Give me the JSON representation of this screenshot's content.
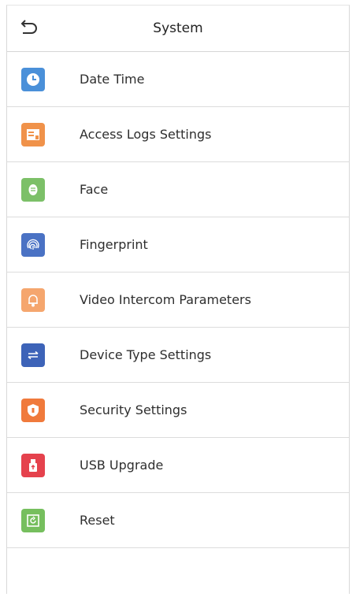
{
  "header": {
    "title": "System",
    "back_icon": "back-arrow-icon"
  },
  "colors": {
    "date_time": "#4a90d9",
    "access_logs": "#f0924a",
    "face": "#7cc068",
    "fingerprint": "#4a72c4",
    "video_intercom": "#f5a66e",
    "device_type": "#3d63b8",
    "security": "#f07a3c",
    "usb": "#e5424d",
    "reset": "#76bf5e"
  },
  "menu": {
    "items": [
      {
        "label": "Date Time",
        "icon": "clock-icon"
      },
      {
        "label": "Access Logs Settings",
        "icon": "logs-icon"
      },
      {
        "label": "Face",
        "icon": "face-icon"
      },
      {
        "label": "Fingerprint",
        "icon": "fingerprint-icon"
      },
      {
        "label": "Video Intercom Parameters",
        "icon": "bell-icon"
      },
      {
        "label": "Device Type Settings",
        "icon": "swap-arrows-icon"
      },
      {
        "label": "Security Settings",
        "icon": "shield-icon"
      },
      {
        "label": "USB Upgrade",
        "icon": "usb-icon"
      },
      {
        "label": "Reset",
        "icon": "reset-icon"
      }
    ]
  }
}
